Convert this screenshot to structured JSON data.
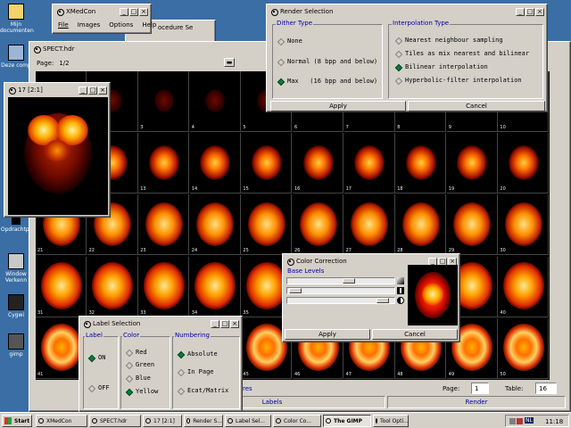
{
  "desktop": {
    "icons": [
      {
        "label": "Mijn documenten"
      },
      {
        "label": "Deze comp"
      },
      {
        "label": "Opdrachtpr"
      },
      {
        "label": "Window Verkenn"
      },
      {
        "label": "Cygwi"
      },
      {
        "label": "gimp"
      }
    ]
  },
  "xmedcon": {
    "title": "XMedCon",
    "menu": [
      "File",
      "Images",
      "Options",
      "Help"
    ],
    "behind_title": "ocedure Se"
  },
  "spect": {
    "title": "SPECT.hdr",
    "page_label": "Page:",
    "page_value": "1/2",
    "footer": {
      "page_label": "Page:",
      "page_value": "1",
      "table_label": "Table:",
      "table_value": "16",
      "labels_button": "Labels",
      "render_button": "Render",
      "partial_text": "res"
    },
    "cells": [
      "1",
      "2",
      "3",
      "4",
      "5",
      "6",
      "7",
      "8",
      "9",
      "10",
      "11",
      "12",
      "13",
      "14",
      "15",
      "16",
      "17",
      "18",
      "19",
      "20",
      "21",
      "22",
      "23",
      "24",
      "25",
      "26",
      "27",
      "28",
      "29",
      "30",
      "31",
      "32",
      "33",
      "34",
      "35",
      "36",
      "37",
      "38",
      "39",
      "40",
      "41",
      "42",
      "43",
      "44",
      "45",
      "46",
      "47",
      "48",
      "49",
      "50"
    ]
  },
  "zoom": {
    "title": "17 [2:1]"
  },
  "render": {
    "title": "Render Selection",
    "dither_group": "Dither Type",
    "dither_options": [
      {
        "label": "None",
        "selected": false
      },
      {
        "label": "Normal (8 bpp and below)",
        "selected": false
      },
      {
        "label": "Max   (16 bpp and below)",
        "selected": true
      }
    ],
    "interp_group": "Interpolation Type",
    "interp_options": [
      {
        "label": "Nearest neighbour sampling",
        "selected": false
      },
      {
        "label": "Tiles as mix nearest and bilinear",
        "selected": false
      },
      {
        "label": "Bilinear interpolation",
        "selected": true
      },
      {
        "label": "Hyperbolic-filter interpolation",
        "selected": false
      }
    ],
    "apply": "Apply",
    "cancel": "Cancel"
  },
  "color": {
    "title": "Color Correction",
    "group": "Base Levels",
    "apply": "Apply",
    "cancel": "Cancel"
  },
  "label_sel": {
    "title": "Label Selection",
    "label_group": "Label",
    "label_options": [
      {
        "label": "ON",
        "selected": true
      },
      {
        "label": "OFF",
        "selected": false
      }
    ],
    "color_group": "Color",
    "color_options": [
      {
        "label": "Red",
        "selected": false
      },
      {
        "label": "Green",
        "selected": false
      },
      {
        "label": "Blue",
        "selected": false
      },
      {
        "label": "Yellow",
        "selected": true
      }
    ],
    "numbering_group": "Numbering",
    "numbering_options": [
      {
        "label": "Absolute",
        "selected": true
      },
      {
        "label": "In Page",
        "selected": false
      },
      {
        "label": "Ecat/Matrix",
        "selected": false
      }
    ]
  },
  "taskbar": {
    "start": "Start",
    "buttons": [
      {
        "label": "XMedCon",
        "pressed": false
      },
      {
        "label": "SPECT.hdr",
        "pressed": false
      },
      {
        "label": "17 [2:1]",
        "pressed": false
      },
      {
        "label": "Render S...",
        "pressed": false
      },
      {
        "label": "Label Sel...",
        "pressed": false
      },
      {
        "label": "Color Co...",
        "pressed": false
      },
      {
        "label": "The GIMP",
        "pressed": true
      },
      {
        "label": "Tool Opti...",
        "pressed": false
      }
    ],
    "tray_lang": "NL",
    "clock": "11:18"
  }
}
